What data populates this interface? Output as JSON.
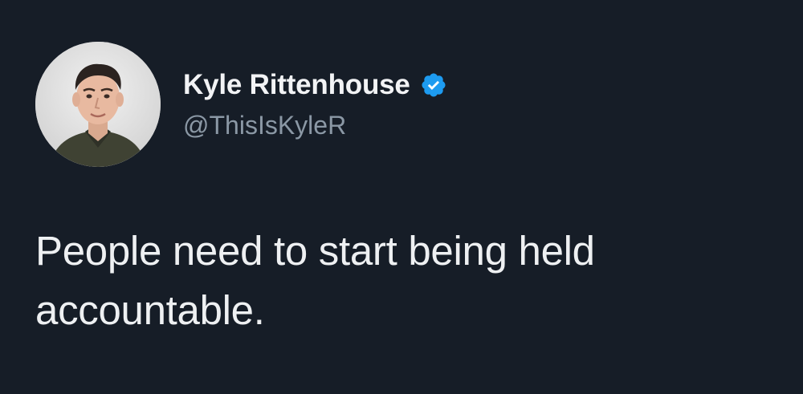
{
  "author": {
    "display_name": "Kyle Rittenhouse",
    "handle": "@ThisIsKyleR",
    "verified": true,
    "verified_badge_color": "#1d9bf0",
    "avatar_icon": "profile-photo"
  },
  "tweet": {
    "text": "People need to start being held accountable."
  },
  "colors": {
    "background": "#161d27",
    "name": "#f2f3f5",
    "handle": "#8b98a5",
    "body_text": "#eef0f2"
  }
}
